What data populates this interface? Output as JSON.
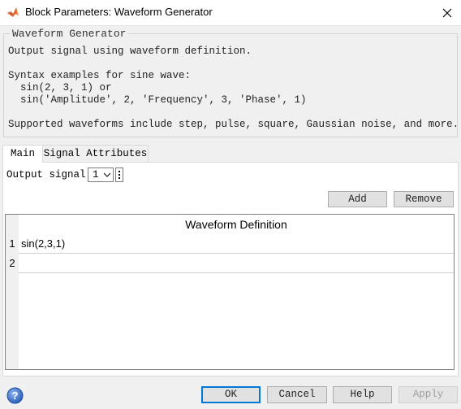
{
  "window": {
    "title": "Block Parameters: Waveform Generator",
    "icons": {
      "app": "matlab-logo-icon",
      "close": "close-icon",
      "help": "question-mark-icon"
    }
  },
  "description": {
    "legend": "Waveform Generator",
    "line1": "Output signal using waveform definition.",
    "line2": "Syntax examples for sine wave:",
    "line3": "  sin(2, 3, 1) or",
    "line4": "  sin('Amplitude', 2, 'Frequency', 3, 'Phase', 1)",
    "line5": "Supported waveforms include step, pulse, square, Gaussian noise, and more."
  },
  "tabs": [
    {
      "label": "Main",
      "active": true
    },
    {
      "label": "Signal Attributes",
      "active": false
    }
  ],
  "main": {
    "output_signal_label": "Output signal:",
    "output_signal_value": "1",
    "add_label": "Add",
    "remove_label": "Remove",
    "table": {
      "header": "Waveform Definition",
      "rows": [
        {
          "num": "1",
          "value": "sin(2,3,1)"
        },
        {
          "num": "2",
          "value": ""
        }
      ]
    }
  },
  "footer": {
    "ok": "OK",
    "cancel": "Cancel",
    "help": "Help",
    "apply": "Apply"
  },
  "colors": {
    "ok_focus_border": "#0078d7",
    "background": "#f0f0f0"
  }
}
